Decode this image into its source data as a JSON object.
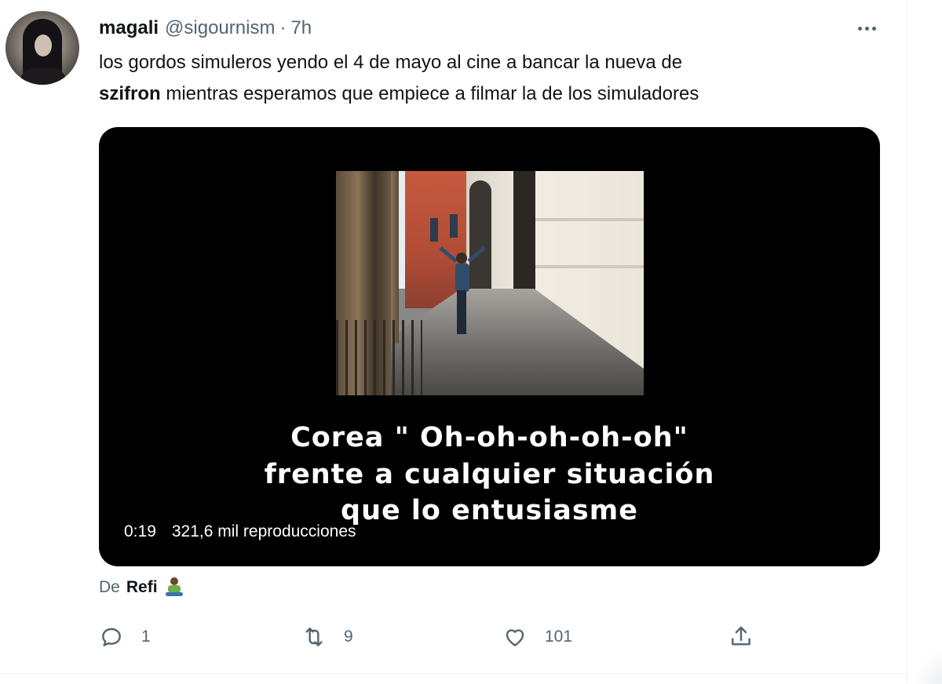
{
  "tweet": {
    "display_name": "magali",
    "handle": "@sigournism",
    "separator": "·",
    "time": "7h",
    "text_line1": "los gordos simuleros yendo el 4 de mayo al cine a bancar la nueva de",
    "mention_bold": "szifron",
    "text_line2_rest": " mientras esperamos que empiece a filmar la de los simuladores"
  },
  "video": {
    "subtitle_lines": [
      "Corea \" Oh-oh-oh-oh-oh\"",
      "frente a cualquier situación",
      "que lo entusiasme"
    ],
    "duration": "0:19",
    "views": "321,6 mil reproducciones"
  },
  "source": {
    "prefix": "De",
    "name": "Refi"
  },
  "actions": {
    "replies": "1",
    "retweets": "9",
    "likes": "101"
  },
  "icons": {
    "more": "more-horizontal-icon",
    "reply": "reply-bubble-icon",
    "retweet": "retweet-arrows-icon",
    "like": "heart-icon",
    "share": "share-upload-icon",
    "source_emoji": "person-in-lotus-position-emoji"
  },
  "colors": {
    "text_primary": "#0f1419",
    "text_secondary": "#536471",
    "media_background": "#000000",
    "divider": "#eff3f4"
  }
}
